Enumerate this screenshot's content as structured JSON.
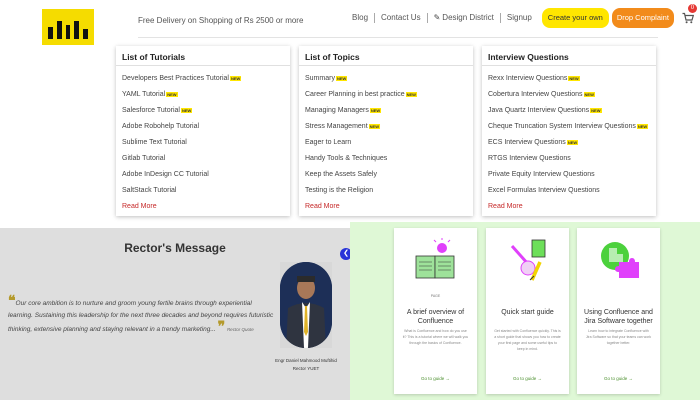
{
  "header": {
    "delivery_text": "Free Delivery on Shopping of Rs 2500 or more",
    "nav": {
      "blog": "Blog",
      "contact": "Contact Us",
      "design_district": "Design District",
      "signup": "Signup",
      "create_own": "Create your own",
      "drop_complaint": "Drop Complaint",
      "cart_count": "0"
    }
  },
  "colors": {
    "logo_yellow": "#f5dc00",
    "create_button": "#ffe600",
    "complaint_button": "#f28b1b",
    "read_more": "#c62828",
    "green_section": "#dff8d6",
    "rector_section": "#dedede"
  },
  "new_badge": "NEW",
  "panels": {
    "tutorials": {
      "title": "List of Tutorials",
      "items": [
        {
          "label": "Developers Best Practices Tutorial",
          "new": true
        },
        {
          "label": "YAML Tutorial",
          "new": true
        },
        {
          "label": "Salesforce Tutorial",
          "new": true
        },
        {
          "label": "Adobe Robohelp Tutorial",
          "new": false
        },
        {
          "label": "Sublime Text Tutorial",
          "new": false
        },
        {
          "label": "Gitlab Tutorial",
          "new": false
        },
        {
          "label": "Adobe InDesign CC Tutorial",
          "new": false
        },
        {
          "label": "SaltStack Tutorial",
          "new": false
        }
      ],
      "read_more": "Read More"
    },
    "topics": {
      "title": "List of Topics",
      "items": [
        {
          "label": "Summary",
          "new": true
        },
        {
          "label": "Career Planning in best practice",
          "new": true
        },
        {
          "label": "Managing Managers",
          "new": true
        },
        {
          "label": "Stress Management",
          "new": true
        },
        {
          "label": "Eager to Learn",
          "new": false
        },
        {
          "label": "Handy Tools & Techniques",
          "new": false
        },
        {
          "label": "Keep the Assets Safely",
          "new": false
        },
        {
          "label": "Testing is the Religion",
          "new": false
        }
      ],
      "read_more": "Read More"
    },
    "interview": {
      "title": "Interview Questions",
      "items": [
        {
          "label": "Rexx Interview Questions",
          "new": true
        },
        {
          "label": "Cobertura Interview Questions",
          "new": true
        },
        {
          "label": "Java Quartz Interview Questions",
          "new": true
        },
        {
          "label": "Cheque Truncation System Interview Questions",
          "new": true
        },
        {
          "label": "ECS Interview Questions",
          "new": true
        },
        {
          "label": "RTGS Interview Questions",
          "new": false
        },
        {
          "label": "Private Equity Interview Questions",
          "new": false
        },
        {
          "label": "Excel Formulas Interview Questions",
          "new": false
        }
      ],
      "read_more": "Read More"
    }
  },
  "rector": {
    "title": "Rector's Message",
    "quote": "Our core ambition is to nurture and groom young fertile brains through experiential learning. Sustaining this leadership for the next three decades and beyond requires futuristic thinking, extensive planning and staying relevant in a trendy marketing...",
    "quote_by": "Rector Quote",
    "name": "Engr Daniel Mahmood Muftihid",
    "role": "Rector YUET"
  },
  "cards": [
    {
      "tag": "PAGE",
      "title": "A brief overview of Confluence",
      "desc": "What is Confluence and how do you use it? This is a tutorial where we will walk you through the basics of Confluence.",
      "link": "Go to guide →",
      "icon": "book-lightbulb-icon"
    },
    {
      "tag": "",
      "title": "Quick start guide",
      "desc": "Get started with Confluence quickly. This is a short guide that shows you how to create your first page and some useful tips to keep in mind.",
      "link": "Go to guide →",
      "icon": "tools-icon"
    },
    {
      "tag": "",
      "title": "Using Confluence and Jira Software together",
      "desc": "Learn how to integrate Confluence with Jira Software so that your teams can work together better.",
      "link": "Go to guide →",
      "icon": "puzzle-icon"
    }
  ]
}
